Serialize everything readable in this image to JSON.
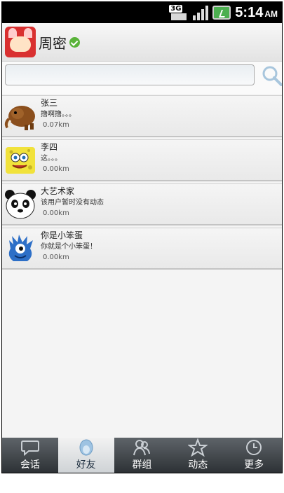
{
  "status_bar": {
    "network": "3G",
    "time": "5:14",
    "ampm": "AM"
  },
  "header": {
    "name": "周密",
    "avatar_icon": "red-fox-cartoon-avatar",
    "verified_icon": "green-check-icon"
  },
  "search": {
    "value": "",
    "icon": "search-icon"
  },
  "friends": [
    {
      "name": "张三",
      "message": "撸啊撸。。。",
      "distance": "0.07km",
      "avatar": "mammoth-avatar"
    },
    {
      "name": "李四",
      "message": "这。。。",
      "distance": "0.00km",
      "avatar": "sponge-avatar"
    },
    {
      "name": "大艺术家",
      "message": "该用户暂时没有动态",
      "distance": "0.00km",
      "avatar": "panda-avatar"
    },
    {
      "name": "你是小笨蛋",
      "message": "你就是个小笨蛋！",
      "distance": "0.00km",
      "avatar": "blue-monster-avatar"
    }
  ],
  "tabs": [
    {
      "label": "会话",
      "icon": "chat-bubble-icon",
      "active": false
    },
    {
      "label": "好友",
      "icon": "friend-penguin-icon",
      "active": true
    },
    {
      "label": "群组",
      "icon": "group-icon",
      "active": false
    },
    {
      "label": "动态",
      "icon": "star-icon",
      "active": false
    },
    {
      "label": "更多",
      "icon": "clock-more-icon",
      "active": false
    }
  ],
  "colors": {
    "status_bar": "#000000",
    "tab_bar": "#3f4448",
    "active_tab": "#e6e8ea",
    "verified": "#5ab33a"
  }
}
